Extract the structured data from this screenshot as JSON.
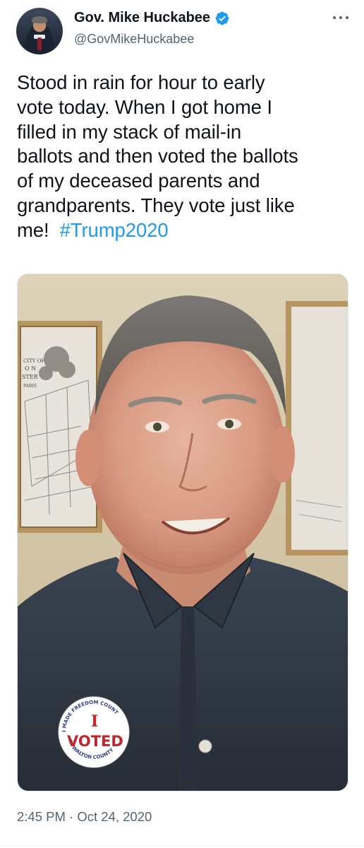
{
  "author": {
    "display_name": "Gov. Mike Huckabee",
    "handle": "@GovMikeHuckabee",
    "verified": true
  },
  "tweet": {
    "text_lines": [
      "Stood in rain for hour to early",
      "vote today. When I got home I",
      "filled in my stack of mail-in",
      "ballots and then voted the ballots",
      "of my deceased parents and",
      "grandparents.  They vote just like",
      "me!  "
    ],
    "hashtag": "#Trump2020",
    "timestamp": "2:45 PM · Oct 24, 2020"
  },
  "photo": {
    "sticker": {
      "top_text": "I MADE FREEDOM COUNT",
      "main_text": "VOTED",
      "letter": "I",
      "bottom_text": "IN WALTON COUNTY"
    },
    "map_print_text": [
      "CITY OF",
      "O N",
      "STER",
      "PARIS"
    ]
  },
  "colors": {
    "link": "#1d9bf0",
    "verified": "#1d9bf0",
    "secondary_text": "#536471"
  },
  "icons": {
    "verified": "verified-badge-icon",
    "more": "more-options-icon"
  }
}
